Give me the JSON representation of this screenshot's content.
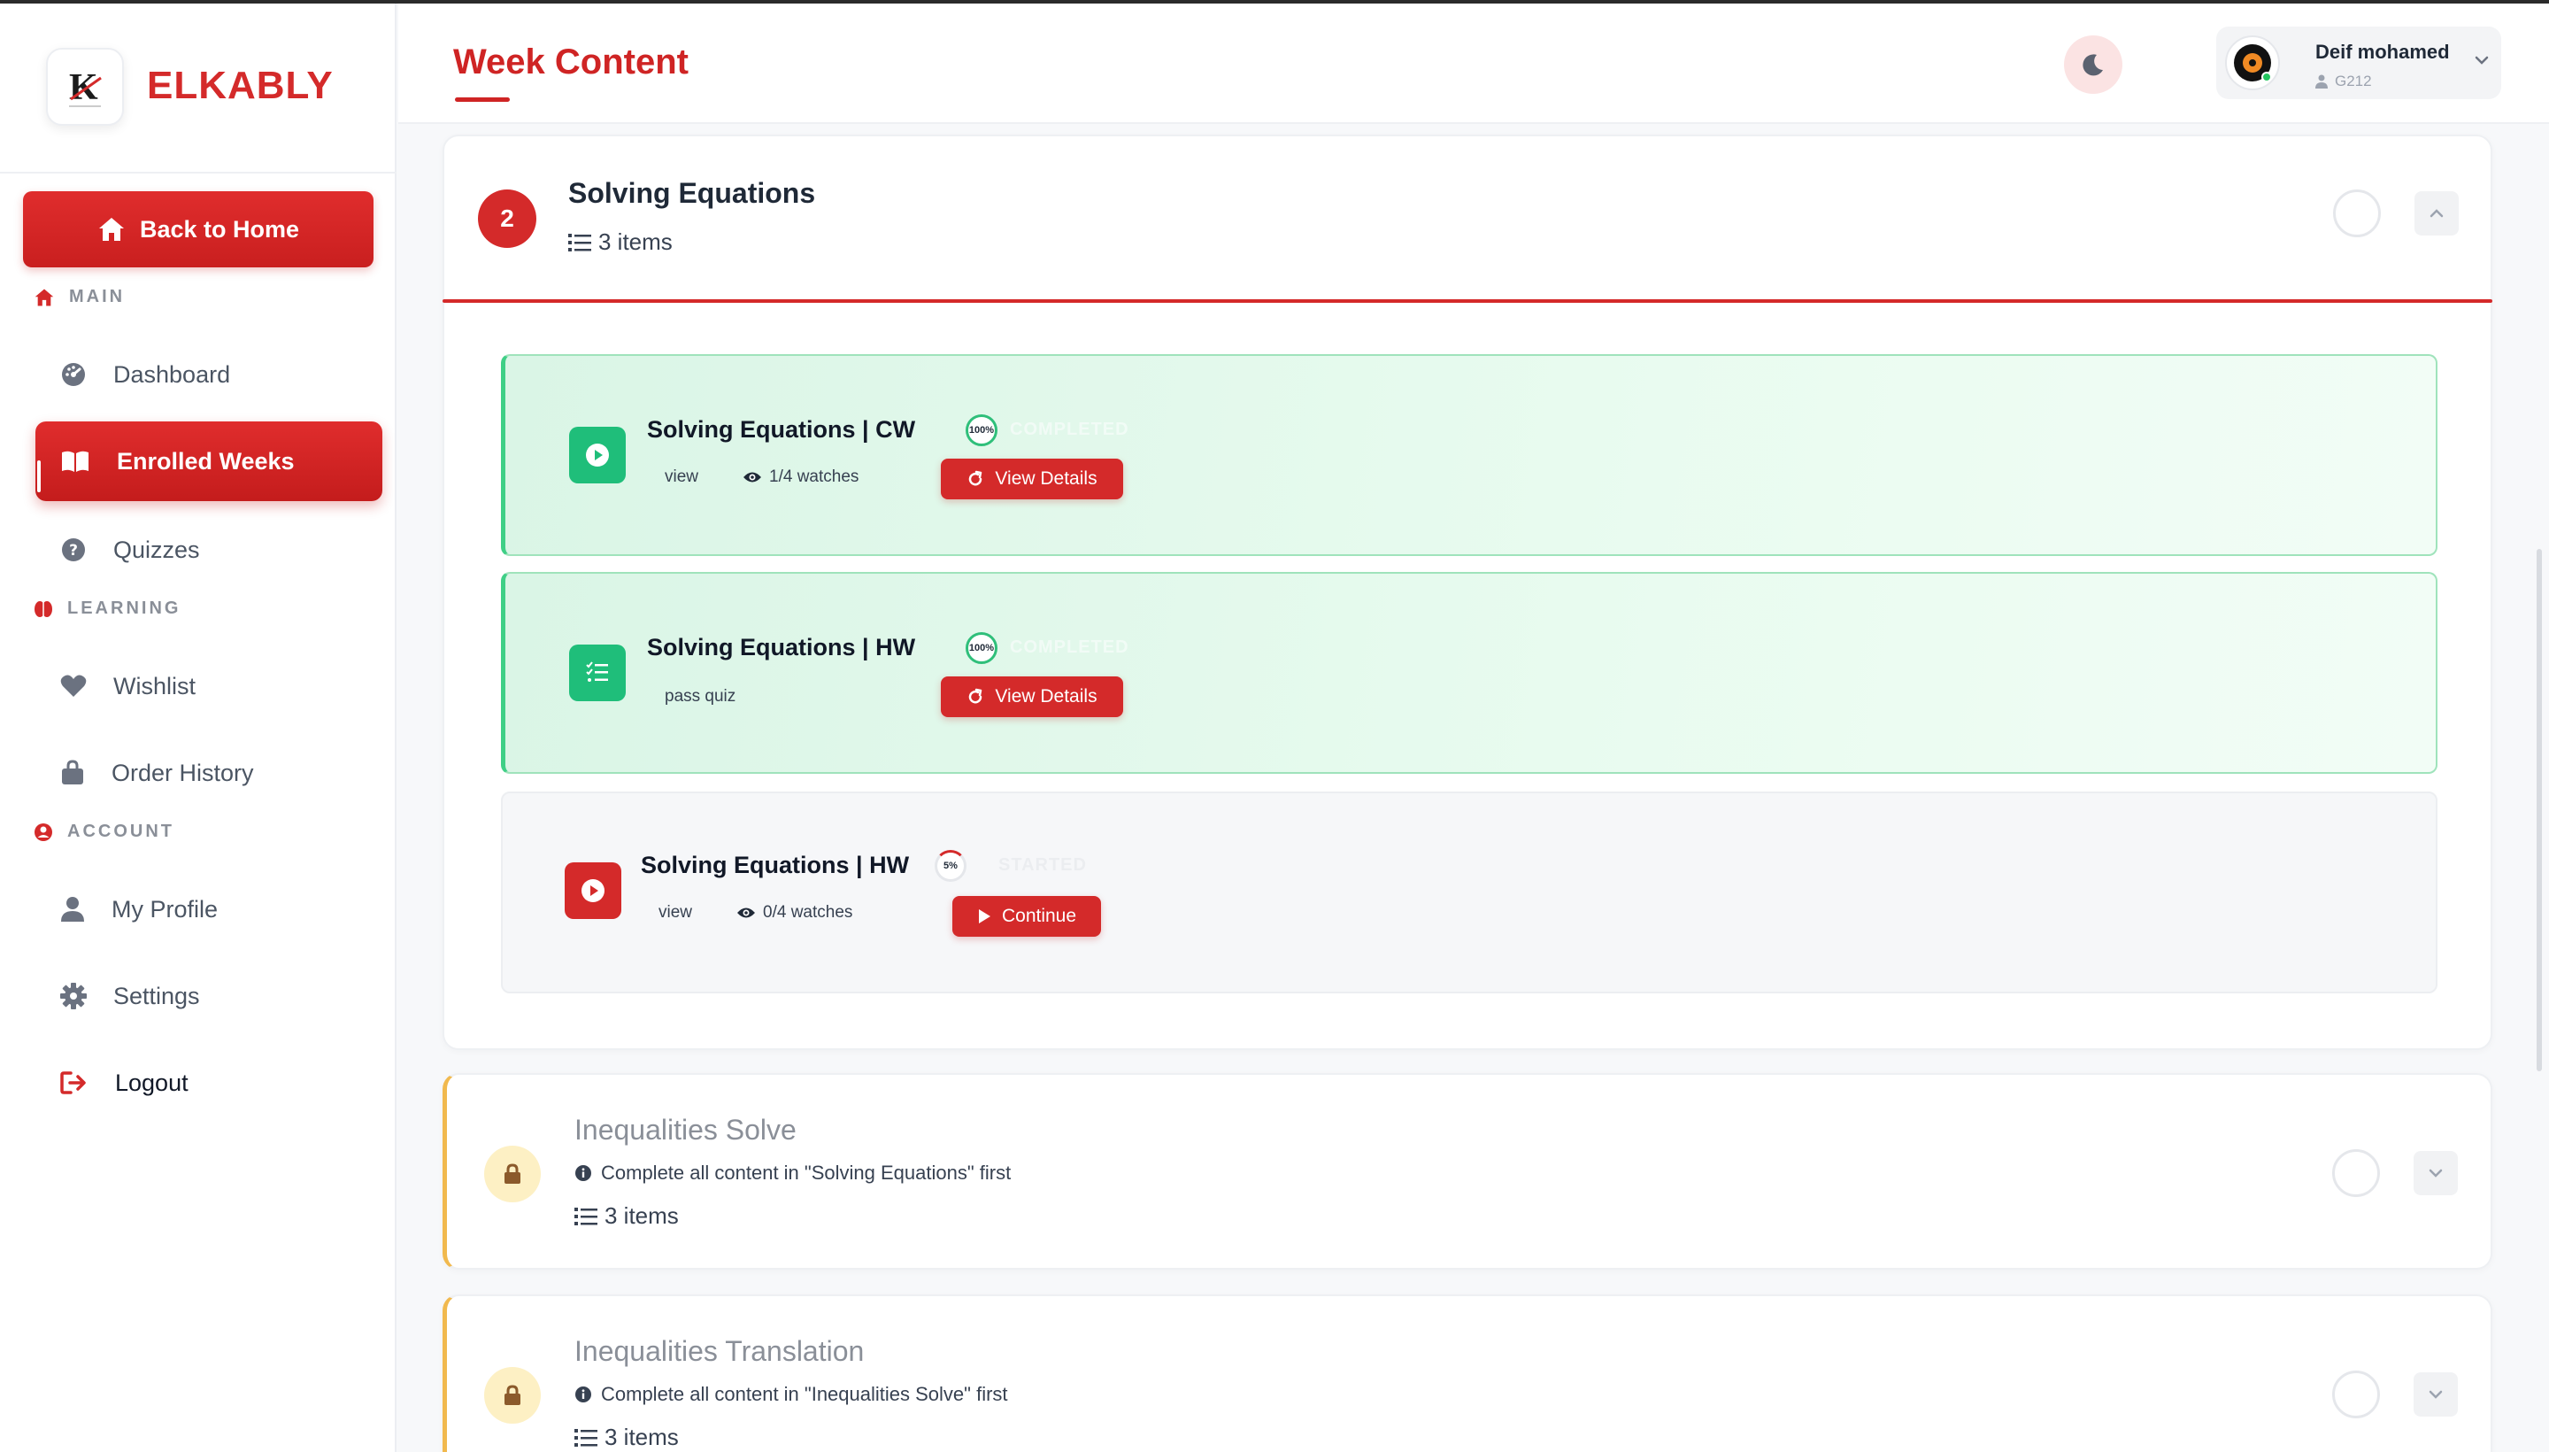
{
  "brand": {
    "name": "ELKABLY"
  },
  "sidebar": {
    "back_label": "Back to Home",
    "sections": {
      "main": "MAIN",
      "learning": "LEARNING",
      "account": "ACCOUNT"
    },
    "items": {
      "dashboard": "Dashboard",
      "enrolled_weeks": "Enrolled Weeks",
      "quizzes": "Quizzes",
      "wishlist": "Wishlist",
      "order_history": "Order History",
      "my_profile": "My Profile",
      "settings": "Settings",
      "logout": "Logout"
    }
  },
  "header": {
    "title": "Week Content",
    "user": {
      "name": "Deif mohamed",
      "code": "G212"
    }
  },
  "open_topic": {
    "number": "2",
    "title": "Solving Equations",
    "items_label": "3 items",
    "contents": [
      {
        "title": "Solving Equations | CW",
        "type_label": "view",
        "watches": "1/4 watches",
        "progress": "100%",
        "status": "COMPLETED",
        "button": "View Details"
      },
      {
        "title": "Solving Equations | HW",
        "type_label": "pass quiz",
        "progress": "100%",
        "status": "COMPLETED",
        "button": "View Details"
      },
      {
        "title": "Solving Equations | HW",
        "type_label": "view",
        "watches": "0/4 watches",
        "progress": "5%",
        "status": "STARTED",
        "button": "Continue"
      }
    ]
  },
  "locked_topics": [
    {
      "title": "Inequalities Solve",
      "note": "Complete all content in \"Solving Equations\" first",
      "items_label": "3 items"
    },
    {
      "title": "Inequalities Translation",
      "note": "Complete all content in \"Inequalities Solve\" first",
      "items_label": "3 items"
    }
  ],
  "colors": {
    "accent": "#d42a2a",
    "success": "#1fbe7a",
    "locked": "#f1b94e"
  }
}
